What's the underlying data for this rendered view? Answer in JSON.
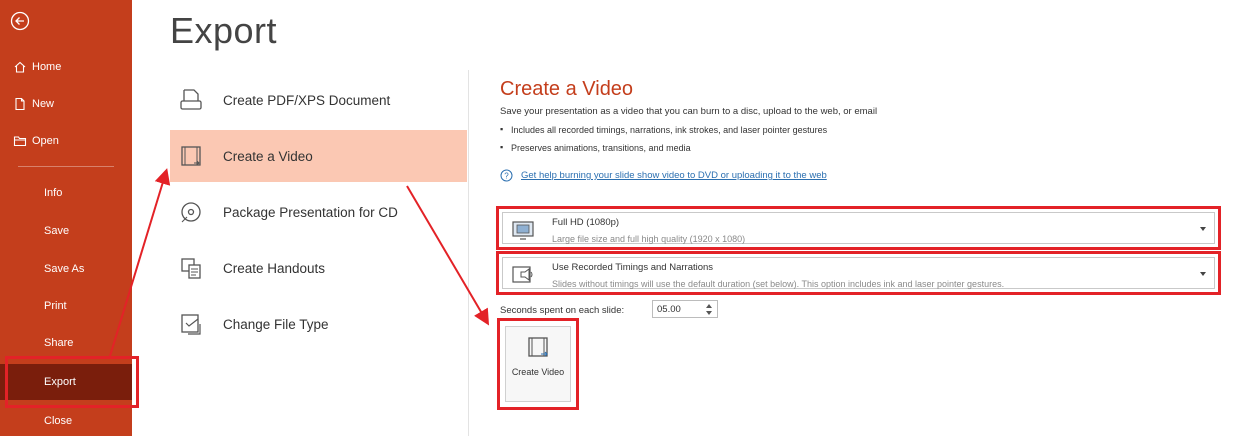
{
  "colors": {
    "sidebar": "#c43e1c",
    "export_selected": "#7a1e0c",
    "selected_item": "#fbc8b3",
    "highlight": "#e32227",
    "accent_text": "#c43e1c",
    "link": "#2b6fb0"
  },
  "sidebar": {
    "back_icon": "back-arrow-icon",
    "items": [
      {
        "label": "Home",
        "icon": "home-icon"
      },
      {
        "label": "New",
        "icon": "new-document-icon"
      },
      {
        "label": "Open",
        "icon": "open-folder-icon"
      },
      {
        "label": "Info"
      },
      {
        "label": "Save"
      },
      {
        "label": "Save As"
      },
      {
        "label": "Print"
      },
      {
        "label": "Share"
      },
      {
        "label": "Export"
      },
      {
        "label": "Close"
      }
    ]
  },
  "main": {
    "title": "Export",
    "options": [
      {
        "label": "Create PDF/XPS Document",
        "icon": "pdf-document-icon"
      },
      {
        "label": "Create a Video",
        "icon": "video-film-icon"
      },
      {
        "label": "Package Presentation for CD",
        "icon": "cd-disc-icon"
      },
      {
        "label": "Create Handouts",
        "icon": "handouts-icon"
      },
      {
        "label": "Change File Type",
        "icon": "change-file-type-icon"
      }
    ]
  },
  "panel": {
    "title": "Create a Video",
    "description": "Save your presentation as a video that you can burn to a disc, upload to the web, or email",
    "bullets": [
      "Includes all recorded timings, narrations, ink strokes, and laser pointer gestures",
      "Preserves animations, transitions, and media"
    ],
    "help_link": "Get help burning your slide show video to DVD or uploading it to the web",
    "quality": {
      "title": "Full HD (1080p)",
      "subtitle": "Large file size and full high quality (1920 x 1080)",
      "icon": "monitor-hd-icon"
    },
    "timings": {
      "title": "Use Recorded Timings and Narrations",
      "subtitle": "Slides without timings will use the default duration (set below). This option includes ink and laser pointer gestures.",
      "icon": "timings-narration-icon"
    },
    "seconds_label": "Seconds spent on each slide:",
    "seconds_value": "05.00",
    "create_button": "Create Video"
  }
}
